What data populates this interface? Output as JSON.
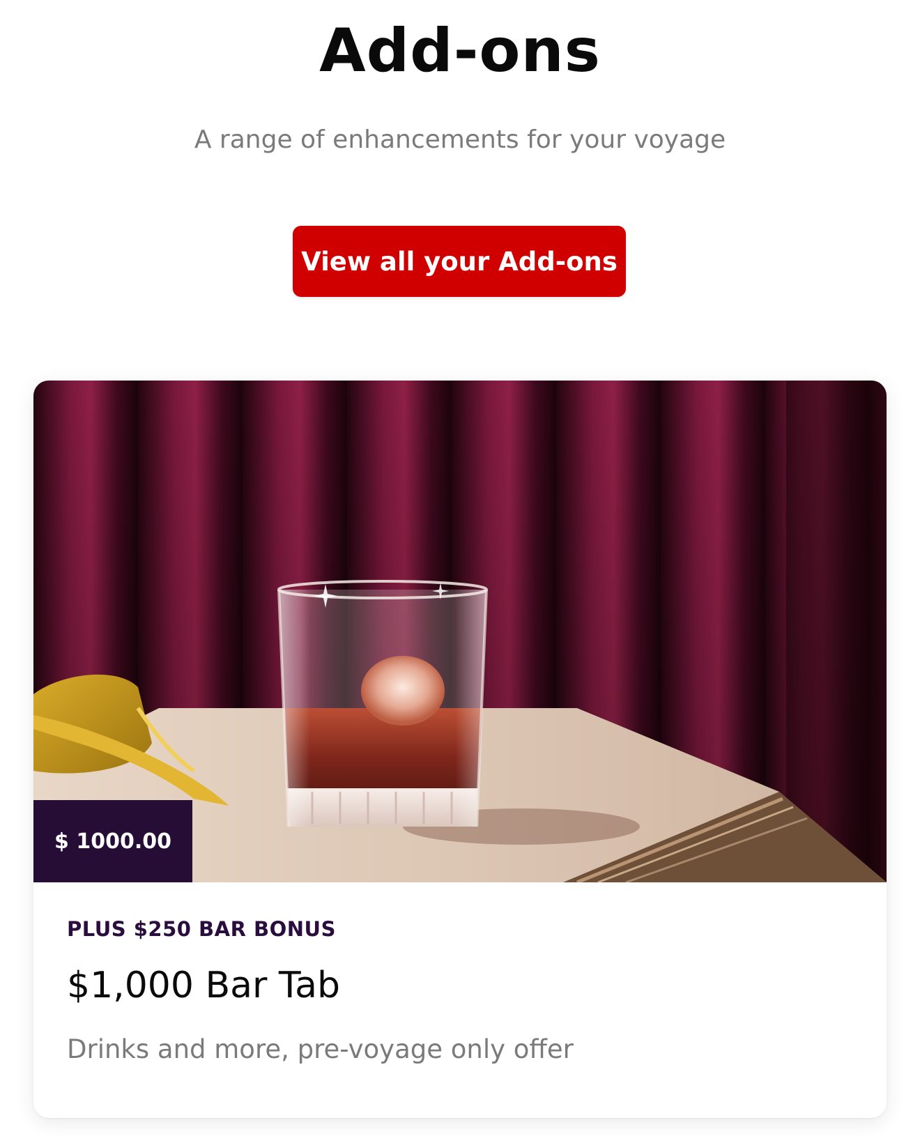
{
  "header": {
    "title": "Add-ons",
    "subtitle": "A range of enhancements for your voyage"
  },
  "cta": {
    "label": "View all your Add-ons"
  },
  "addon_card": {
    "price": "$ 1000.00",
    "eyebrow": "PLUS $250 BAR BONUS",
    "title": "$1,000 Bar Tab",
    "description": "Drinks and more, pre-voyage only offer",
    "image": "whiskey-glass-on-table-photo"
  },
  "colors": {
    "accent": "#d10000",
    "badge": "#250d36",
    "eyebrow": "#2a0d3e",
    "muted_text": "#7a7a7a"
  }
}
